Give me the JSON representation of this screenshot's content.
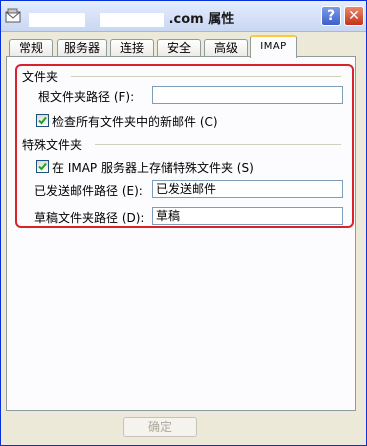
{
  "window": {
    "title_suffix": ".com 属性",
    "help_symbol": "?",
    "close_symbol": "✕",
    "app_icon": "mail-account-icon"
  },
  "tabs": [
    {
      "label": "常规",
      "active": false
    },
    {
      "label": "服务器",
      "active": false
    },
    {
      "label": "连接",
      "active": false
    },
    {
      "label": "安全",
      "active": false
    },
    {
      "label": "高级",
      "active": false
    },
    {
      "label": "IMAP",
      "active": true
    }
  ],
  "folders_section": {
    "title": "文件夹",
    "root_path_label": "根文件夹路径 (F):",
    "root_path_value": "",
    "check_new_mail_label": "检查所有文件夹中的新邮件 (C)",
    "check_new_mail_checked": true
  },
  "special_section": {
    "title": "特殊文件夹",
    "store_special_label": "在 IMAP 服务器上存储特殊文件夹 (S)",
    "store_special_checked": true,
    "sent_path_label": "已发送邮件路径 (E):",
    "sent_path_value": "已发送邮件",
    "drafts_path_label": "草稿文件夹路径 (D):",
    "drafts_path_value": "草稿"
  },
  "footer": {
    "ok_label": "确定"
  },
  "colors": {
    "highlight": "#d8232a",
    "titlebar": "#d6e1f8",
    "dialog_bg": "#ece9d8"
  }
}
